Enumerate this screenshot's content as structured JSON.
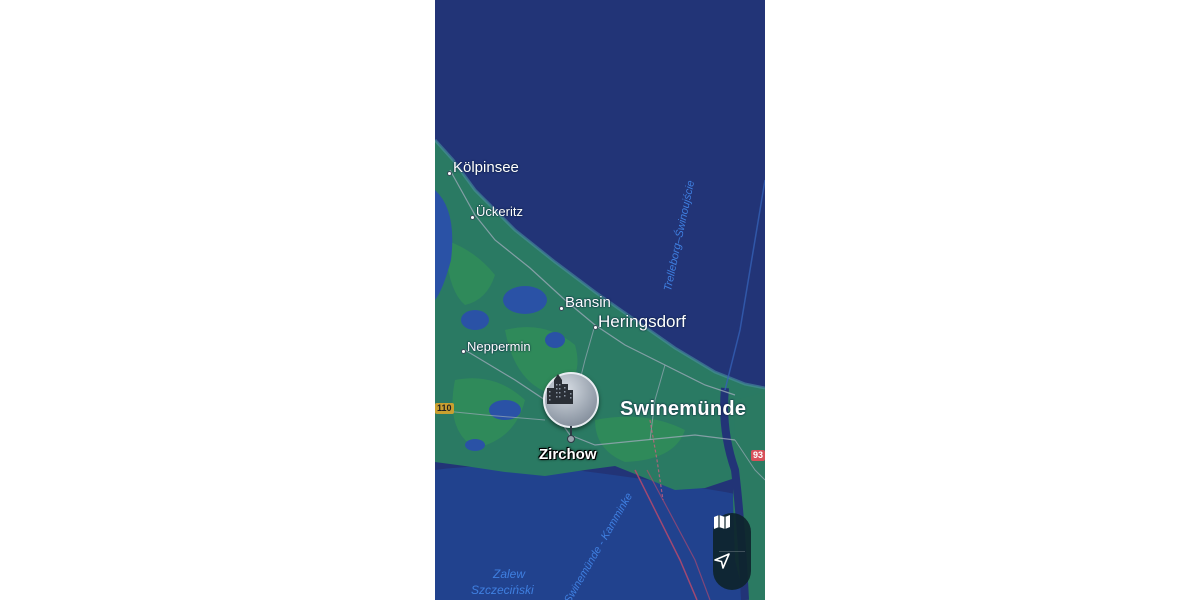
{
  "map": {
    "colors": {
      "sea": "#223477",
      "land": "#2a7a63",
      "forest": "#2f8a5a",
      "lagoon": "#1f4fa0",
      "road": "#9aa9b7",
      "ferry": "#c04a6a"
    },
    "places": {
      "koelpinsee": "Kölpinsee",
      "ueckeritz": "Ückeritz",
      "bansin": "Bansin",
      "heringsdorf": "Heringsdorf",
      "neppermin": "Neppermin",
      "swinemuende": "Swinemünde"
    },
    "selected_place": {
      "name": "Zirchow",
      "icon": "city-buildings-icon"
    },
    "water_labels": {
      "zalew_line1": "Zalew",
      "zalew_line2": "Szczeciński",
      "ferry_route": "Trelleborg–Świnoujście",
      "channel": "Swinemünde - Kamminke"
    },
    "route_badges": {
      "west": "110",
      "east": "93"
    }
  },
  "controls": {
    "map_mode_icon": "map-icon",
    "location_icon": "location-arrow-icon"
  }
}
